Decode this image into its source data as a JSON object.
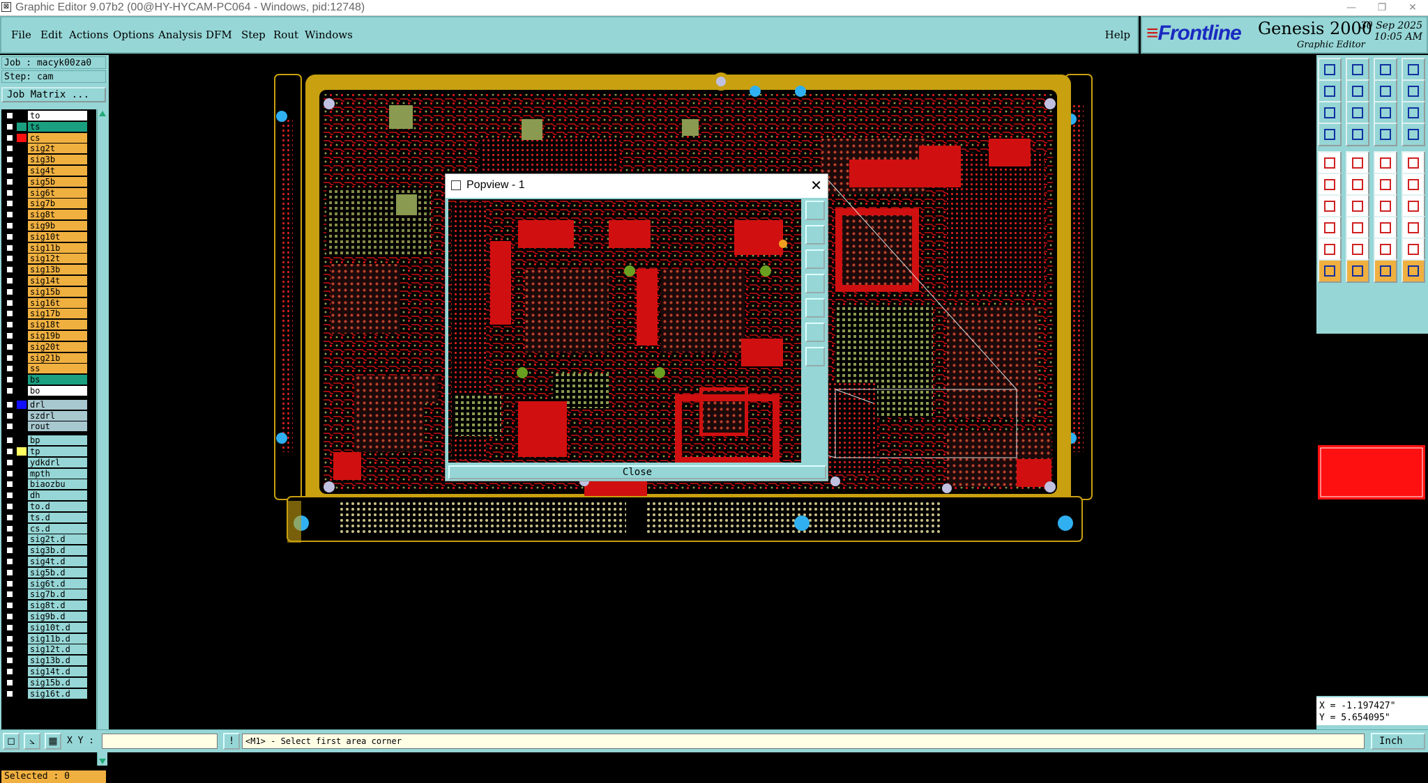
{
  "window": {
    "title": "Graphic Editor 9.07b2 (00@HY-HYCAM-PC064 - Windows, pid:12748)"
  },
  "menu": [
    "File",
    "Edit",
    "Actions",
    "Options",
    "Analysis",
    "DFM",
    "Step",
    "Rout",
    "Windows"
  ],
  "help": "Help",
  "brand": {
    "logo": "Frontline",
    "product": "Genesis 2000",
    "subtitle": "Graphic Editor",
    "date": "30 Sep 2025",
    "time": "10:05 AM"
  },
  "job": {
    "job_line": "Job : macyk00za0",
    "step_line": "Step: cam",
    "matrix_button": "Job Matrix ..."
  },
  "layers": [
    {
      "name": "to",
      "bg": "#ffffff",
      "swatch": "#000000"
    },
    {
      "name": "ts",
      "bg": "#1aa080",
      "swatch": "#1aa080"
    },
    {
      "name": "cs",
      "bg": "#f0b040",
      "swatch": "#ff1010"
    },
    {
      "name": "sig2t",
      "bg": "#f0b040",
      "swatch": "#000000"
    },
    {
      "name": "sig3b",
      "bg": "#f0b040",
      "swatch": "#000000"
    },
    {
      "name": "sig4t",
      "bg": "#f0b040",
      "swatch": "#000000"
    },
    {
      "name": "sig5b",
      "bg": "#f0b040",
      "swatch": "#000000"
    },
    {
      "name": "sig6t",
      "bg": "#f0b040",
      "swatch": "#000000"
    },
    {
      "name": "sig7b",
      "bg": "#f0b040",
      "swatch": "#000000"
    },
    {
      "name": "sig8t",
      "bg": "#f0b040",
      "swatch": "#000000"
    },
    {
      "name": "sig9b",
      "bg": "#f0b040",
      "swatch": "#000000"
    },
    {
      "name": "sig10t",
      "bg": "#f0b040",
      "swatch": "#000000"
    },
    {
      "name": "sig11b",
      "bg": "#f0b040",
      "swatch": "#000000"
    },
    {
      "name": "sig12t",
      "bg": "#f0b040",
      "swatch": "#000000"
    },
    {
      "name": "sig13b",
      "bg": "#f0b040",
      "swatch": "#000000"
    },
    {
      "name": "sig14t",
      "bg": "#f0b040",
      "swatch": "#000000"
    },
    {
      "name": "sig15b",
      "bg": "#f0b040",
      "swatch": "#000000"
    },
    {
      "name": "sig16t",
      "bg": "#f0b040",
      "swatch": "#000000"
    },
    {
      "name": "sig17b",
      "bg": "#f0b040",
      "swatch": "#000000"
    },
    {
      "name": "sig18t",
      "bg": "#f0b040",
      "swatch": "#000000"
    },
    {
      "name": "sig19b",
      "bg": "#f0b040",
      "swatch": "#000000"
    },
    {
      "name": "sig20t",
      "bg": "#f0b040",
      "swatch": "#000000"
    },
    {
      "name": "sig21b",
      "bg": "#f0b040",
      "swatch": "#000000"
    },
    {
      "name": "ss",
      "bg": "#f0b040",
      "swatch": "#000000"
    },
    {
      "name": "bs",
      "bg": "#1aa080",
      "swatch": "#000000"
    },
    {
      "name": "bo",
      "bg": "#ffffff",
      "swatch": "#000000"
    },
    {
      "name": "drl",
      "bg": "#a8c8d0",
      "swatch": "#1010ff"
    },
    {
      "name": "szdrl",
      "bg": "#a8c8d0",
      "swatch": "#000000"
    },
    {
      "name": "rout",
      "bg": "#a8c8d0",
      "swatch": "#000000"
    },
    {
      "name": "bp",
      "bg": "#96d6d6",
      "swatch": "#000000"
    },
    {
      "name": "tp",
      "bg": "#96d6d6",
      "swatch": "#ffff60"
    },
    {
      "name": "ydkdrl",
      "bg": "#96d6d6",
      "swatch": "#000000"
    },
    {
      "name": "mpth",
      "bg": "#96d6d6",
      "swatch": "#000000"
    },
    {
      "name": "biaozbu",
      "bg": "#96d6d6",
      "swatch": "#000000"
    },
    {
      "name": "dh",
      "bg": "#96d6d6",
      "swatch": "#000000"
    },
    {
      "name": "to.d",
      "bg": "#96d6d6",
      "swatch": "#000000"
    },
    {
      "name": "ts.d",
      "bg": "#96d6d6",
      "swatch": "#000000"
    },
    {
      "name": "cs.d",
      "bg": "#96d6d6",
      "swatch": "#000000"
    },
    {
      "name": "sig2t.d",
      "bg": "#96d6d6",
      "swatch": "#000000"
    },
    {
      "name": "sig3b.d",
      "bg": "#96d6d6",
      "swatch": "#000000"
    },
    {
      "name": "sig4t.d",
      "bg": "#96d6d6",
      "swatch": "#000000"
    },
    {
      "name": "sig5b.d",
      "bg": "#96d6d6",
      "swatch": "#000000"
    },
    {
      "name": "sig6t.d",
      "bg": "#96d6d6",
      "swatch": "#000000"
    },
    {
      "name": "sig7b.d",
      "bg": "#96d6d6",
      "swatch": "#000000"
    },
    {
      "name": "sig8t.d",
      "bg": "#96d6d6",
      "swatch": "#000000"
    },
    {
      "name": "sig9b.d",
      "bg": "#96d6d6",
      "swatch": "#000000"
    },
    {
      "name": "sig10t.d",
      "bg": "#96d6d6",
      "swatch": "#000000"
    },
    {
      "name": "sig11b.d",
      "bg": "#96d6d6",
      "swatch": "#000000"
    },
    {
      "name": "sig12t.d",
      "bg": "#96d6d6",
      "swatch": "#000000"
    },
    {
      "name": "sig13b.d",
      "bg": "#96d6d6",
      "swatch": "#000000"
    },
    {
      "name": "sig14t.d",
      "bg": "#96d6d6",
      "swatch": "#000000"
    },
    {
      "name": "sig15b.d",
      "bg": "#96d6d6",
      "swatch": "#000000"
    },
    {
      "name": "sig16t.d",
      "bg": "#96d6d6",
      "swatch": "#000000"
    }
  ],
  "selected": "Selected : 0",
  "popview": {
    "title": "Popview - 1",
    "close_label": "Close"
  },
  "coords": {
    "x": "X = -1.197427\"",
    "y": "Y = 5.654095\""
  },
  "status": {
    "xy_label": "X Y :",
    "xy_value": "",
    "prompt": "<M1> - Select first area corner",
    "units": "Inch"
  },
  "colors": {
    "panel": "#96d6d6",
    "board_gold": "#c8a010",
    "copper_red": "#ff1010",
    "pad_green": "#8a9a50",
    "highlight_orange": "#f0b040"
  }
}
